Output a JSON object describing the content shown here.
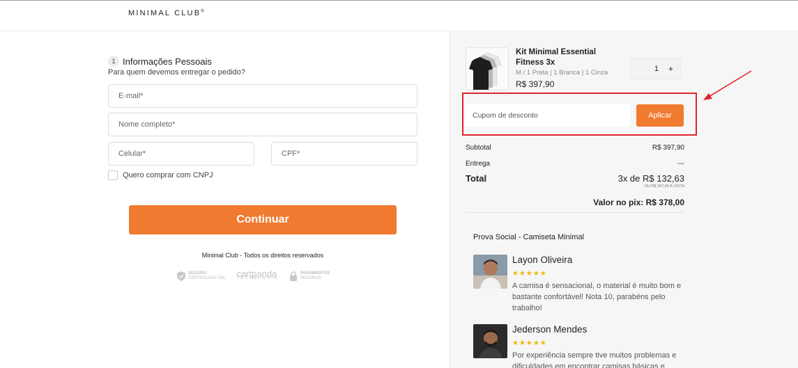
{
  "header": {
    "logo": "MINIMAL CLUB",
    "logo_mark": "®"
  },
  "form": {
    "step_number": "1",
    "step_title": "Informações Pessoais",
    "step_subtitle": "Para quem devemos entregar o pedido?",
    "email_placeholder": "E-mail*",
    "name_placeholder": "Nome completo*",
    "phone_placeholder": "Celular*",
    "cpf_placeholder": "CPF*",
    "cnpj_label": "Quero comprar com CNPJ",
    "continue_label": "Continuar",
    "footer": "Minimal Club - Todos os direitos reservados"
  },
  "badges": {
    "secure_line1": "SEGURO",
    "secure_line2": "CERTIFICADO SSL",
    "cartpanda": "cartpanda",
    "cartpanda_sub": "TECNOLOGIA",
    "payments_line1": "PAGAMENTOS",
    "payments_line2": "SEGUROS"
  },
  "cart": {
    "product_name": "Kit Minimal Essential Fitness 3x",
    "product_variant": "M / 1 Preta | 1 Branca | 1 Cinza",
    "product_price": "R$ 397,90",
    "quantity": "1",
    "qty_plus": "+",
    "coupon_placeholder": "Cupom de desconto",
    "apply_label": "Aplicar",
    "subtotal_label": "Subtotal",
    "subtotal_value": "R$ 397,90",
    "shipping_label": "Entrega",
    "shipping_value": "---",
    "total_label": "Total",
    "total_value": "3x de R$ 132,63",
    "total_note": "OU R$ 397,90 À VISTA",
    "pix_label": "Valor no pix: R$ 378,00"
  },
  "social": {
    "title": "Prova Social - Camiseta Minimal",
    "reviews": [
      {
        "name": "Layon Oliveira",
        "stars": "★★★★★",
        "text": "A camisa é sensacional, o material é muito bom e bastante confortável! Nota 10, parabéns pelo trabalho!"
      },
      {
        "name": "Jederson Mendes",
        "stars": "★★★★★",
        "text": "Por experiência sempre tive muitos problemas e dificuldades em encontrar camisas básicas e"
      }
    ]
  },
  "colors": {
    "accent": "#f07a2f",
    "highlight": "#e0232b",
    "star": "#f2b705"
  }
}
